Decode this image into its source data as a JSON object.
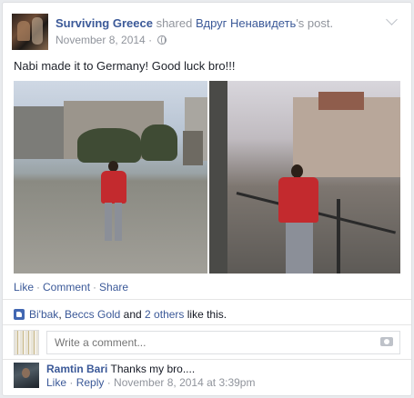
{
  "post": {
    "author": "Surviving Greece",
    "shared_text": "shared",
    "source_name": "Вдруг Ненавидеть",
    "source_suffix": "'s post.",
    "date": "November 8, 2014",
    "date_sep": " · ",
    "audience_icon": "globe-icon",
    "text": "Nabi made it to Germany! Good luck bro!!!"
  },
  "actions": {
    "like": "Like",
    "comment": "Comment",
    "share": "Share",
    "sep": "·"
  },
  "likes": {
    "name1": "Bi'bak",
    "comma": ", ",
    "name2": "Beccs Gold",
    "and": " and ",
    "others": "2 others",
    "suffix": " like this."
  },
  "comment_input": {
    "placeholder": "Write a comment..."
  },
  "comments": [
    {
      "author": "Ramtin Bari",
      "text": "Thanks my bro....",
      "like": "Like",
      "reply": "Reply",
      "sep": " · ",
      "timestamp": "November 8, 2014 at 3:39pm"
    }
  ],
  "colors": {
    "link": "#3b5998",
    "muted": "#90949c",
    "background": "#e9ebee"
  }
}
